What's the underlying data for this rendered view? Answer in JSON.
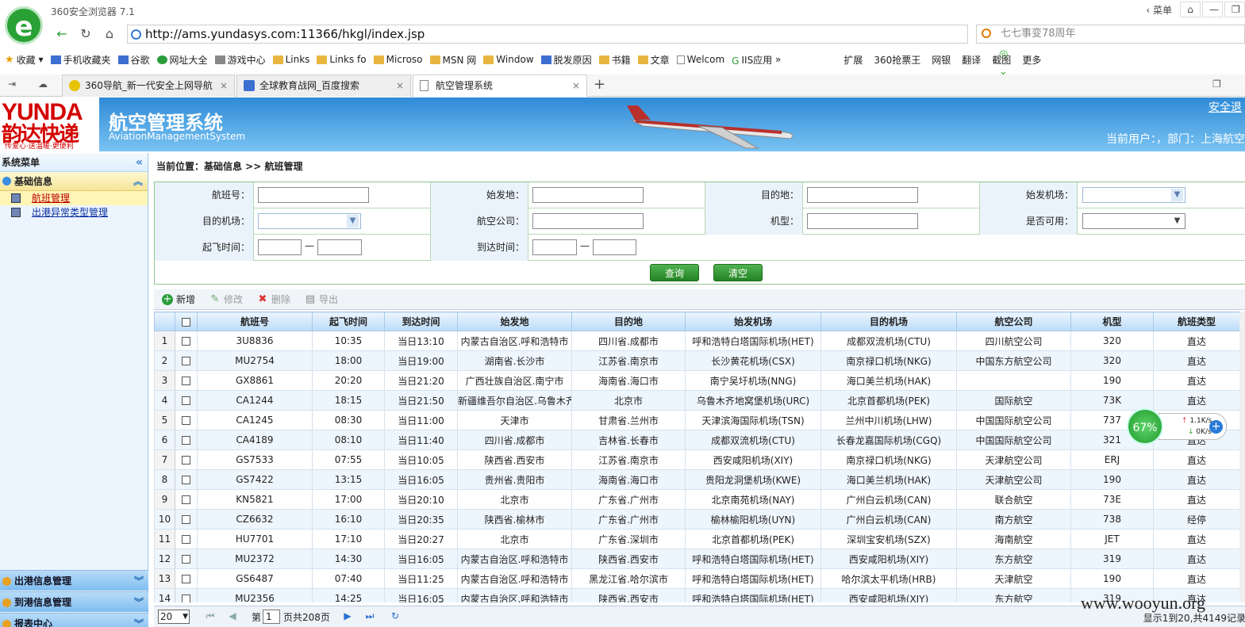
{
  "browser": {
    "title": "360安全浏览器 7.1",
    "win_menu": "菜单",
    "url": "http://ams.yundasys.com:11366/hkgl/index.jsp",
    "search_placeholder": "七七事变78周年",
    "bookmarks": [
      {
        "label": "收藏",
        "icon": "star-icon"
      },
      {
        "label": "手机收藏夹",
        "icon": "phone-icon"
      },
      {
        "label": "谷歌",
        "icon": "google-icon"
      },
      {
        "label": "网址大全",
        "icon": "url-icon"
      },
      {
        "label": "游戏中心",
        "icon": "game-icon"
      },
      {
        "label": "Links",
        "icon": "folder-icon"
      },
      {
        "label": "Links fo",
        "icon": "folder-icon"
      },
      {
        "label": "Microso",
        "icon": "folder-icon"
      },
      {
        "label": "MSN 网",
        "icon": "folder-icon"
      },
      {
        "label": "Window",
        "icon": "folder-icon"
      },
      {
        "label": "脱发原因",
        "icon": "baidu-icon"
      },
      {
        "label": "书籍",
        "icon": "folder-icon"
      },
      {
        "label": "文章",
        "icon": "folder-icon"
      },
      {
        "label": "Welcom",
        "icon": "page-icon"
      },
      {
        "label": "IIS应用",
        "icon": "iis-icon"
      }
    ],
    "right_tools": [
      "扩展",
      "360抢票王",
      "网银",
      "翻译",
      "截图",
      "更多"
    ],
    "tabs": [
      {
        "label": "360导航_新一代安全上网导航"
      },
      {
        "label": "全球教育战网_百度搜索"
      },
      {
        "label": "航空管理系统"
      }
    ]
  },
  "header": {
    "logo_en": "YUNDA",
    "logo_cn": "韵达快递",
    "logo_slogan": "传爱心·送温暖·更便利",
    "title": "航空管理系统",
    "subtitle": "AviationManagementSystem",
    "safe_exit": "安全退",
    "current_user": "当前用户：，部门：上海航空"
  },
  "sidebar": {
    "title": "系统菜单",
    "group": "基础信息",
    "items": [
      "航班管理",
      "出港异常类型管理"
    ],
    "bottom_groups": [
      "出港信息管理",
      "到港信息管理",
      "报表中心"
    ]
  },
  "main": {
    "breadcrumb": "当前位置：基础信息 >> 航班管理",
    "form": {
      "flight_no": "航班号：",
      "origin": "始发地：",
      "destination": "目的地：",
      "origin_airport": "始发机场：",
      "dest_airport": "目的机场：",
      "airline": "航空公司：",
      "model": "机型：",
      "enabled": "是否可用：",
      "depart_time": "起飞时间：",
      "arrive_time": "到达时间：",
      "dash": "—",
      "query": "查询",
      "clear": "清空"
    },
    "toolbar": {
      "add": "新增",
      "edit": "修改",
      "delete": "删除",
      "export": "导出"
    },
    "columns": [
      "航班号",
      "起飞时间",
      "到达时间",
      "始发地",
      "目的地",
      "始发机场",
      "目的机场",
      "航空公司",
      "机型",
      "航班类型"
    ],
    "rows": [
      [
        "1",
        "3U8836",
        "10:35",
        "当日13:10",
        "内蒙古自治区.呼和浩特市",
        "四川省.成都市",
        "呼和浩特白塔国际机场(HET)",
        "成都双流机场(CTU)",
        "四川航空公司",
        "320",
        "直达"
      ],
      [
        "2",
        "MU2754",
        "18:00",
        "当日19:00",
        "湖南省.长沙市",
        "江苏省.南京市",
        "长沙黄花机场(CSX)",
        "南京禄口机场(NKG)",
        "中国东方航空公司",
        "320",
        "直达"
      ],
      [
        "3",
        "GX8861",
        "20:20",
        "当日21:20",
        "广西壮族自治区.南宁市",
        "海南省.海口市",
        "南宁吴圩机场(NNG)",
        "海口美兰机场(HAK)",
        "",
        "190",
        "直达"
      ],
      [
        "4",
        "CA1244",
        "18:15",
        "当日21:50",
        "新疆维吾尔自治区.乌鲁木齐",
        "北京市",
        "乌鲁木齐地窝堡机场(URC)",
        "北京首都机场(PEK)",
        "国际航空",
        "73K",
        "直达"
      ],
      [
        "5",
        "CA1245",
        "08:30",
        "当日11:00",
        "天津市",
        "甘肃省.兰州市",
        "天津滨海国际机场(TSN)",
        "兰州中川机场(LHW)",
        "中国国际航空公司",
        "737",
        "直达"
      ],
      [
        "6",
        "CA4189",
        "08:10",
        "当日11:40",
        "四川省.成都市",
        "吉林省.长春市",
        "成都双流机场(CTU)",
        "长春龙嘉国际机场(CGQ)",
        "中国国际航空公司",
        "321",
        "直达"
      ],
      [
        "7",
        "GS7533",
        "07:55",
        "当日10:05",
        "陕西省.西安市",
        "江苏省.南京市",
        "西安咸阳机场(XIY)",
        "南京禄口机场(NKG)",
        "天津航空公司",
        "ERJ",
        "直达"
      ],
      [
        "8",
        "GS7422",
        "13:15",
        "当日16:05",
        "贵州省.贵阳市",
        "海南省.海口市",
        "贵阳龙洞堡机场(KWE)",
        "海口美兰机场(HAK)",
        "天津航空公司",
        "190",
        "直达"
      ],
      [
        "9",
        "KN5821",
        "17:00",
        "当日20:10",
        "北京市",
        "广东省.广州市",
        "北京南苑机场(NAY)",
        "广州白云机场(CAN)",
        "联合航空",
        "73E",
        "直达"
      ],
      [
        "10",
        "CZ6632",
        "16:10",
        "当日20:35",
        "陕西省.榆林市",
        "广东省.广州市",
        "榆林榆阳机场(UYN)",
        "广州白云机场(CAN)",
        "南方航空",
        "738",
        "经停"
      ],
      [
        "11",
        "HU7701",
        "17:10",
        "当日20:27",
        "北京市",
        "广东省.深圳市",
        "北京首都机场(PEK)",
        "深圳宝安机场(SZX)",
        "海南航空",
        "JET",
        "直达"
      ],
      [
        "12",
        "MU2372",
        "14:30",
        "当日16:05",
        "内蒙古自治区.呼和浩特市",
        "陕西省.西安市",
        "呼和浩特白塔国际机场(HET)",
        "西安咸阳机场(XIY)",
        "东方航空",
        "319",
        "直达"
      ],
      [
        "13",
        "GS6487",
        "07:40",
        "当日11:25",
        "内蒙古自治区.呼和浩特市",
        "黑龙江省.哈尔滨市",
        "呼和浩特白塔国际机场(HET)",
        "哈尔滨太平机场(HRB)",
        "天津航空",
        "190",
        "直达"
      ],
      [
        "14",
        "MU2356",
        "14:25",
        "当日16:05",
        "内蒙古自治区.呼和浩特市",
        "陕西省.西安市",
        "呼和浩特白塔国际机场(HET)",
        "西安咸阳机场(XIY)",
        "东方航空",
        "319",
        "直达"
      ]
    ],
    "pager": {
      "page_size": "20",
      "page_prefix": "第",
      "page_no": "1",
      "page_suffix": "页共208页",
      "info": "显示1到20,共4149记录"
    }
  },
  "speed_widget": {
    "percent": "67%",
    "up": "1.1K/s",
    "down": "0K/s"
  },
  "watermark": "www.wooyun.org",
  "colors": {
    "header_blue": "#2f8ad6",
    "logo_red": "#d40000",
    "button_green": "#238323"
  }
}
